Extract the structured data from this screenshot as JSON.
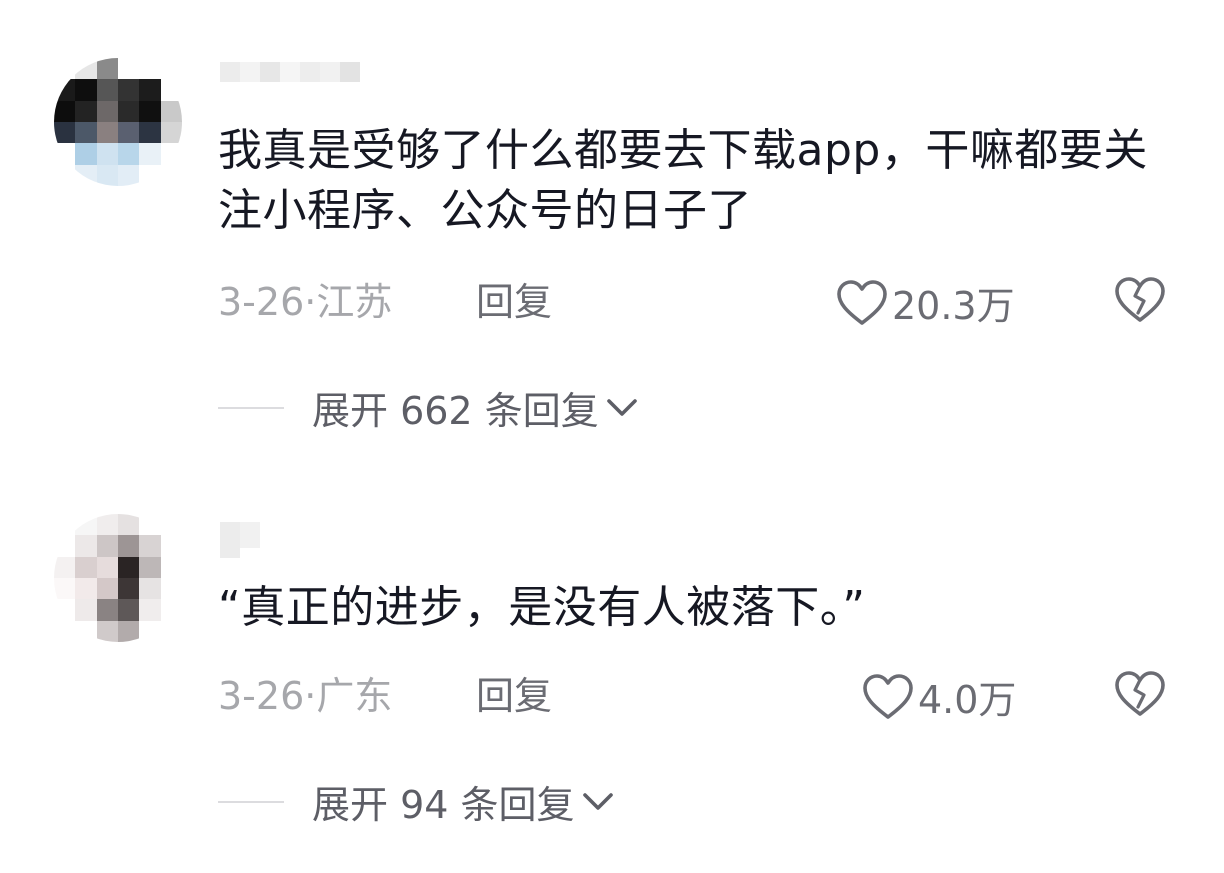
{
  "colors": {
    "text_primary": "#161823",
    "text_meta": "#a6a7ab",
    "text_secondary": "#6b6c73",
    "divider": "#dcdcdf"
  },
  "comments": [
    {
      "avatar_icon": "pixelated-avatar-icon",
      "username_blurred": true,
      "text": "我真是受够了什么都要去下载app，干嘛都要关注小程序、公众号的日子了",
      "date_location": "3-26·江苏",
      "reply_label": "回复",
      "like_count": "20.3万",
      "expand_label": "展开 662 条回复"
    },
    {
      "avatar_icon": "pixelated-avatar-icon",
      "username_blurred": true,
      "text": "“真正的进步，是没有人被落下。”",
      "date_location": "3-26·广东",
      "reply_label": "回复",
      "like_count": "4.0万",
      "expand_label": "展开 94 条回复"
    }
  ]
}
